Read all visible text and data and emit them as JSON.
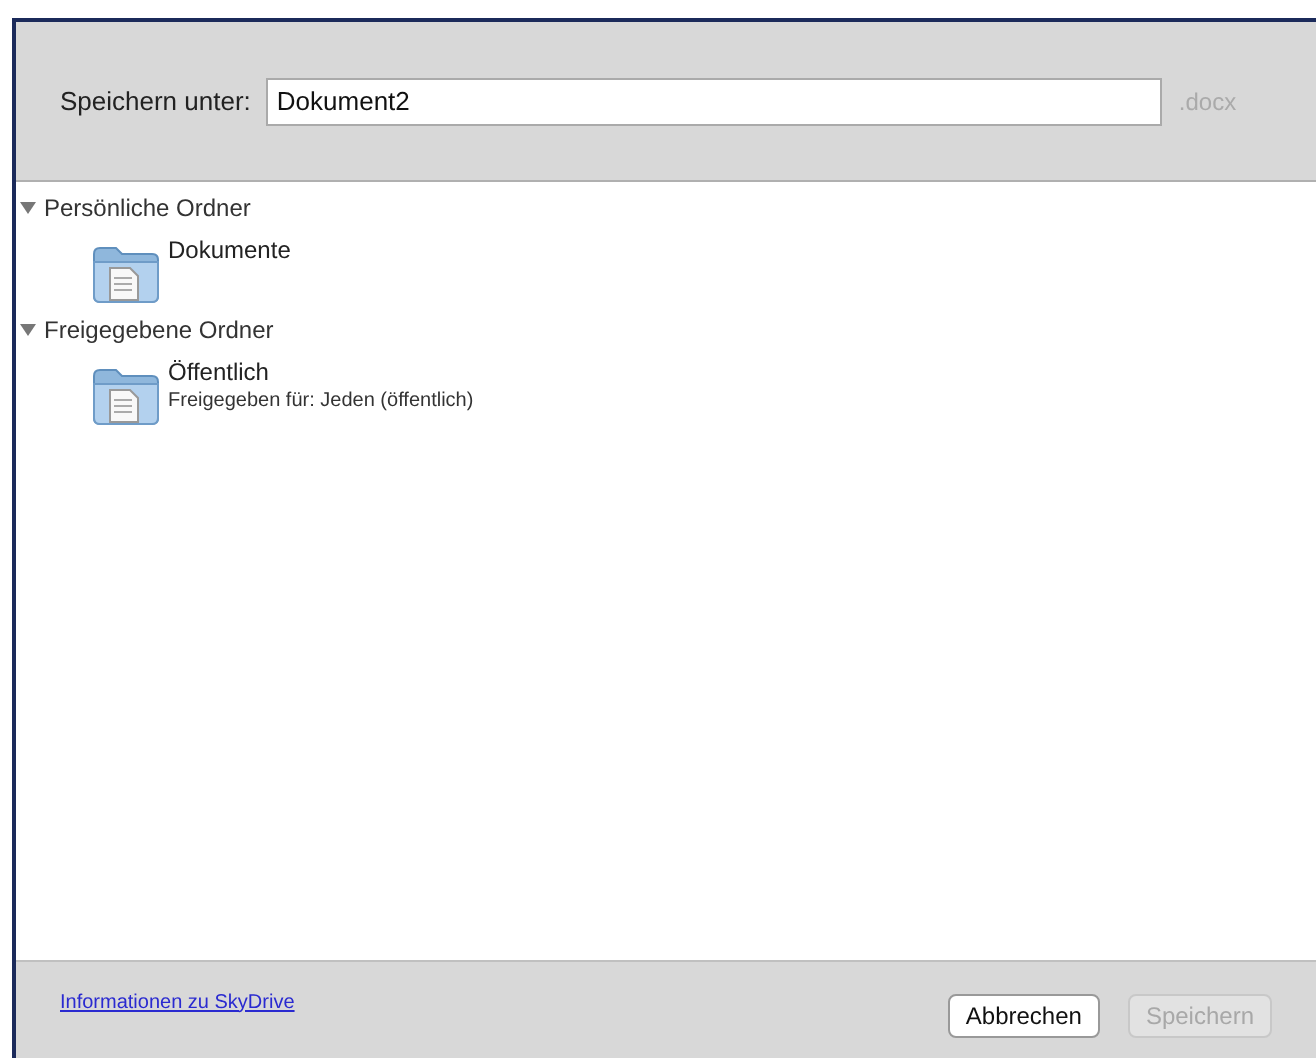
{
  "save_as": {
    "label": "Speichern unter:",
    "value": "Dokument2",
    "extension": ".docx"
  },
  "groups": [
    {
      "title": "Persönliche Ordner",
      "expanded": true,
      "children": [
        {
          "name": "Dokumente"
        }
      ]
    },
    {
      "title": "Freigegebene Ordner",
      "expanded": true,
      "children": [
        {
          "name": "Öffentlich",
          "detail": "Freigegeben für: Jeden (öffentlich)"
        }
      ]
    }
  ],
  "footer": {
    "link": "Informationen zu SkyDrive",
    "buttons": [
      {
        "label": "Abbrechen",
        "disabled": false
      },
      {
        "label": "Speichern",
        "disabled": true
      }
    ]
  }
}
